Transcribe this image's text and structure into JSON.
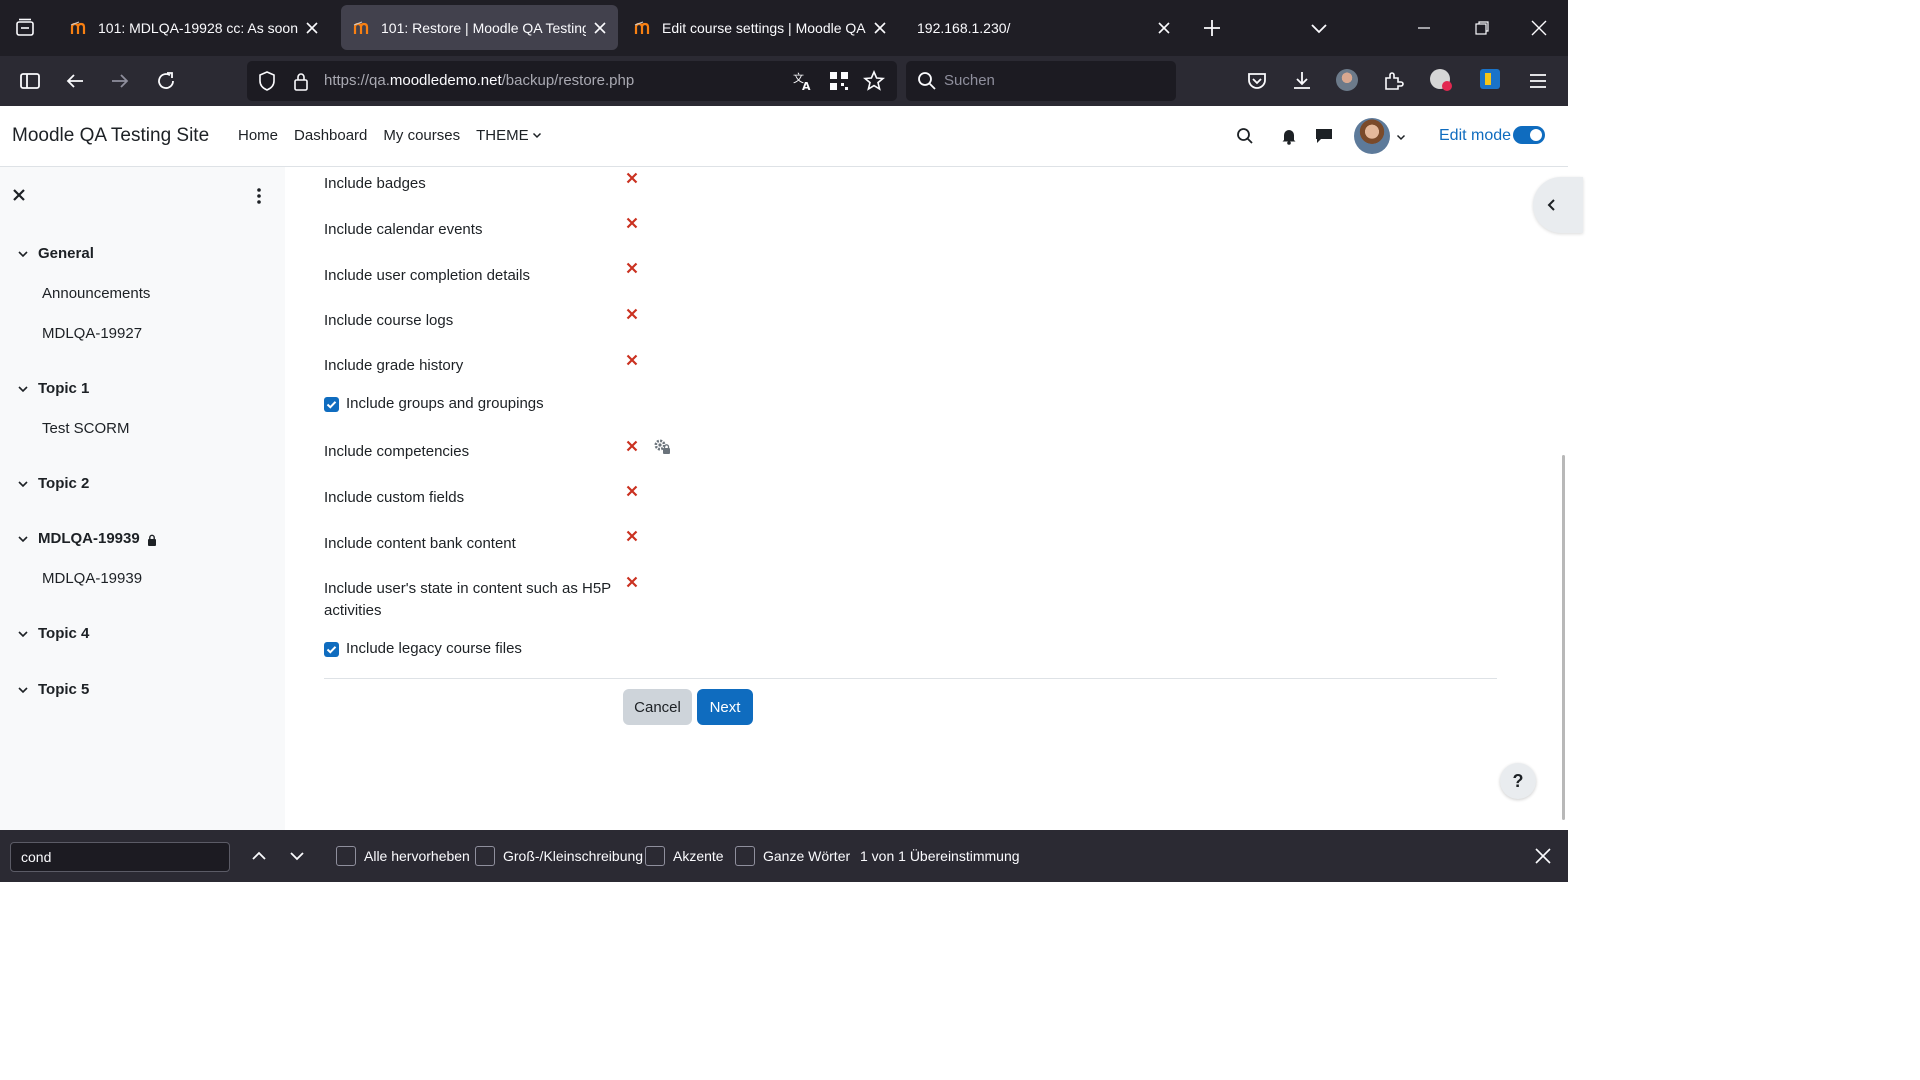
{
  "browser": {
    "tabs": [
      {
        "title": "101: MDLQA-19928 cc: As soon as we l",
        "active": false,
        "icon": "moodle-favicon"
      },
      {
        "title": "101: Restore | Moodle QA Testing Site",
        "active": true,
        "icon": "moodle-favicon"
      },
      {
        "title": "Edit course settings | Moodle QA Testin",
        "active": false,
        "icon": "moodle-favicon"
      },
      {
        "title": "192.168.1.230/",
        "active": false,
        "icon": ""
      }
    ],
    "url_prefix": "https://qa.",
    "url_host": "moodledemo.net",
    "url_path": "/backup/restore.php",
    "search_placeholder": "Suchen"
  },
  "header": {
    "site_name": "Moodle QA Testing Site",
    "nav": {
      "home": "Home",
      "dashboard": "Dashboard",
      "my_courses": "My courses",
      "theme": "THEME"
    },
    "edit_mode": "Edit mode",
    "edit_mode_on": true,
    "accent": "#0f6cbf"
  },
  "course_index": {
    "sections": [
      {
        "title": "General",
        "items": [
          "Announcements",
          "MDLQA-19927"
        ]
      },
      {
        "title": "Topic 1",
        "items": [
          "Test SCORM"
        ]
      },
      {
        "title": "Topic 2",
        "items": []
      },
      {
        "title": "MDLQA-19939",
        "items": [
          "MDLQA-19939"
        ],
        "locked": true
      },
      {
        "title": "Topic 4",
        "items": []
      },
      {
        "title": "Topic 5",
        "items": []
      }
    ]
  },
  "settings": {
    "badges": "Include badges",
    "calendar": "Include calendar events",
    "completion": "Include user completion details",
    "logs": "Include course logs",
    "grade_history": "Include grade history",
    "groups": "Include groups and groupings",
    "competencies": "Include competencies",
    "custom_fields": "Include custom fields",
    "content_bank": "Include content bank content",
    "h5p_state_line1": "Include user's state in content such as H5P",
    "h5p_state_line2": "activities",
    "legacy_files": "Include legacy course files",
    "disabled_color": "#ca3120"
  },
  "buttons": {
    "cancel": "Cancel",
    "next": "Next",
    "help": "?"
  },
  "findbar": {
    "query": "cond",
    "highlight_all": "Alle hervorheben",
    "match_case": "Groß-/Kleinschreibung",
    "accents": "Akzente",
    "whole_words": "Ganze Wörter",
    "status": "1 von 1 Übereinstimmung"
  }
}
